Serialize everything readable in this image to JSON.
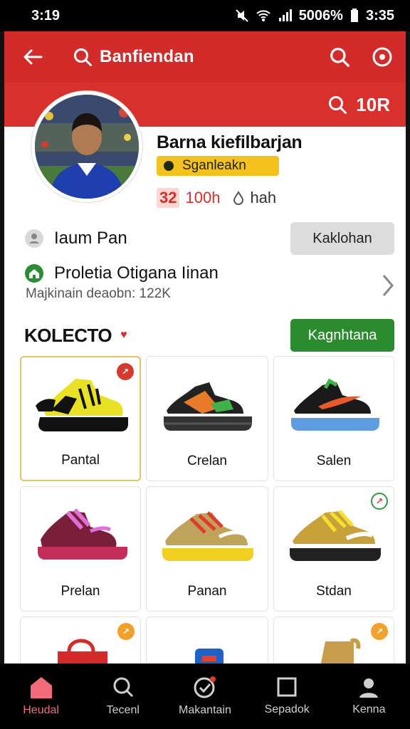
{
  "status_bar": {
    "time": "3:19",
    "battery": "5006%",
    "clock": "3:35"
  },
  "header": {
    "title": "Banfiendan",
    "count": "10R"
  },
  "profile": {
    "name": "Barna kiefilbarjan",
    "badge": "Sganleakn",
    "stat_num": "32",
    "stat_value": "100h",
    "stat_extra": "hah"
  },
  "follow_row": {
    "label": "Iaum Pan",
    "button": "Kaklohan"
  },
  "info_row": {
    "title": "Proletia Otigana Iinan",
    "subtitle": "Majkinain deaobn: 122K"
  },
  "collection": {
    "title": "KOLECTO",
    "button": "Kagnhtana"
  },
  "products": [
    {
      "name": "Pantal",
      "tag_color": "#d43b2e"
    },
    {
      "name": "Crelan",
      "tag_color": ""
    },
    {
      "name": "Salen",
      "tag_color": ""
    },
    {
      "name": "Prelan",
      "tag_color": ""
    },
    {
      "name": "Panan",
      "tag_color": ""
    },
    {
      "name": "Stdan",
      "tag_color": "#2f9a3e"
    }
  ],
  "nav": [
    {
      "label": "Heudal",
      "icon": "home-icon",
      "active": true
    },
    {
      "label": "Tecenl",
      "icon": "search-icon",
      "active": false
    },
    {
      "label": "Makantain",
      "icon": "checklist-icon",
      "active": false
    },
    {
      "label": "Sepadok",
      "icon": "square-icon",
      "active": false
    },
    {
      "label": "Kenna",
      "icon": "profile-icon",
      "active": false
    }
  ],
  "colors": {
    "primary": "#d32a2a",
    "accent_green": "#2a8c2f",
    "badge_yellow": "#f4c21e"
  }
}
